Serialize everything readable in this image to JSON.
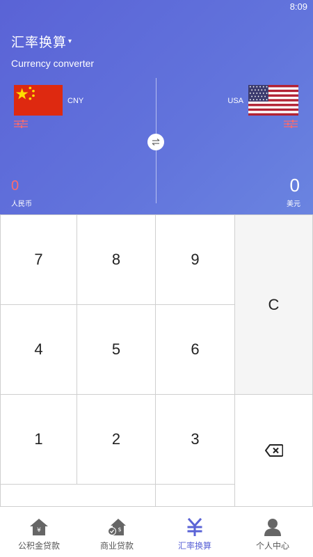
{
  "status_bar": {
    "time": "8:09"
  },
  "header": {
    "title": "汇率换算",
    "title_caret": "▾",
    "subtitle": "Currency converter",
    "accent_color": "#5a63d6"
  },
  "from_currency": {
    "flag": "china-flag-icon",
    "code": "CNY",
    "amount": "0",
    "name": "人民币",
    "amount_color": "#ff6b6b"
  },
  "to_currency": {
    "flag": "usa-flag-icon",
    "code": "USA",
    "amount": "0",
    "name": "美元"
  },
  "keypad": {
    "keys": [
      "7",
      "8",
      "9",
      "4",
      "5",
      "6",
      "1",
      "2",
      "3"
    ],
    "clear": "C",
    "backspace": "backspace-icon"
  },
  "tabs": [
    {
      "label": "公积金贷款",
      "icon": "house-yen-icon",
      "active": false
    },
    {
      "label": "商业贷款",
      "icon": "house-dollar-icon",
      "active": false
    },
    {
      "label": "汇率换算",
      "icon": "yen-icon",
      "active": true
    },
    {
      "label": "个人中心",
      "icon": "person-icon",
      "active": false
    }
  ]
}
